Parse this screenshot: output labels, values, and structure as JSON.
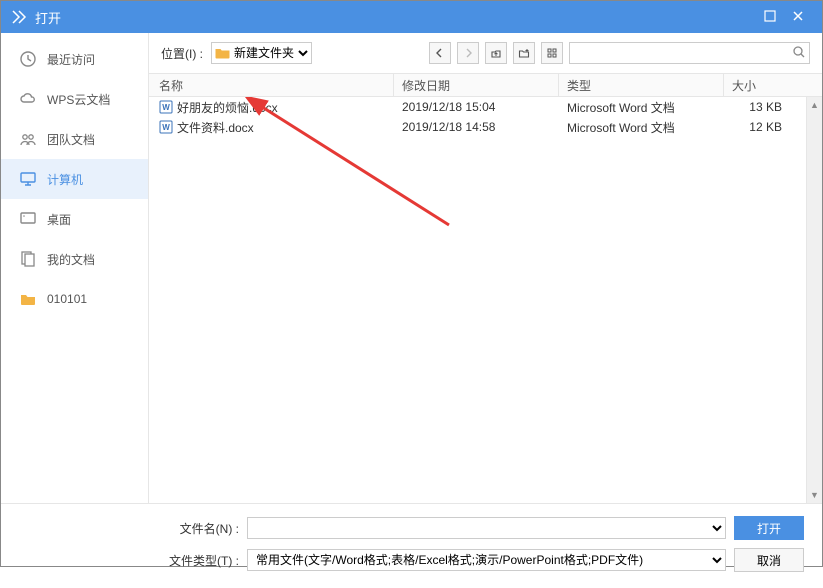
{
  "titlebar": {
    "title": "打开"
  },
  "sidebar": {
    "items": [
      {
        "label": "最近访问"
      },
      {
        "label": "WPS云文档"
      },
      {
        "label": "团队文档"
      },
      {
        "label": "计算机"
      },
      {
        "label": "桌面"
      },
      {
        "label": "我的文档"
      },
      {
        "label": "010101"
      }
    ]
  },
  "locbar": {
    "label": "位置(I) :",
    "current_path": "新建文件夹"
  },
  "columns": {
    "name": "名称",
    "date": "修改日期",
    "type": "类型",
    "size": "大小"
  },
  "files": [
    {
      "name": "好朋友的烦恼.docx",
      "date": "2019/12/18 15:04",
      "type": "Microsoft Word 文档",
      "size": "13 KB"
    },
    {
      "name": "文件资料.docx",
      "date": "2019/12/18 14:58",
      "type": "Microsoft Word 文档",
      "size": "12 KB"
    }
  ],
  "footer": {
    "filename_label": "文件名(N) :",
    "filename_value": "",
    "filetype_label": "文件类型(T) :",
    "filetype_value": "常用文件(文字/Word格式;表格/Excel格式;演示/PowerPoint格式;PDF文件)",
    "open_button": "打开",
    "cancel_button": "取消"
  }
}
